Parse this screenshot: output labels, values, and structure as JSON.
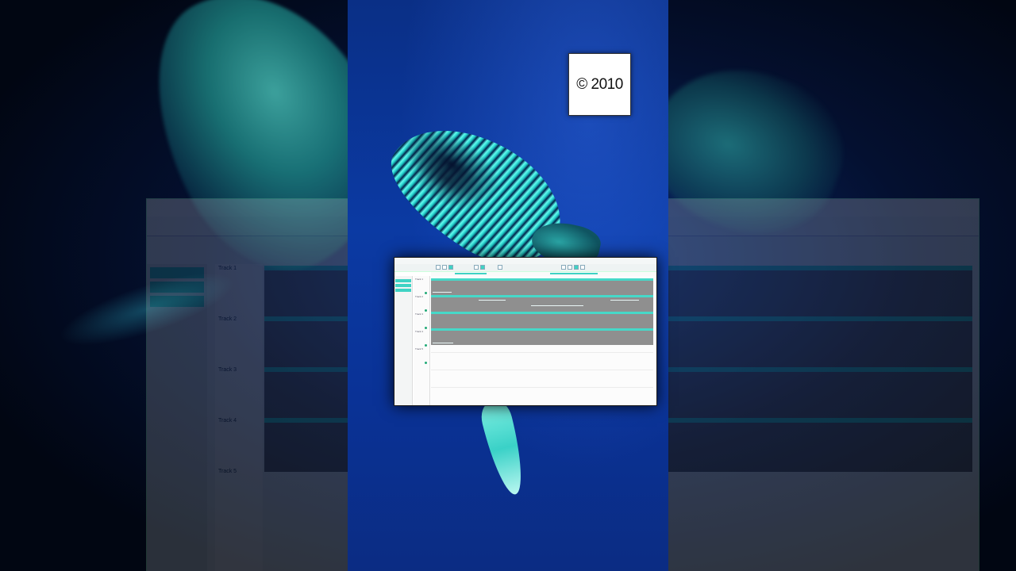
{
  "overlay": {
    "copyright": "© 2010"
  },
  "daw": {
    "tracks": [
      {
        "label": "Track 1"
      },
      {
        "label": "Track 2"
      },
      {
        "label": "Track 3"
      },
      {
        "label": "Track 4"
      },
      {
        "label": "Track 5"
      }
    ],
    "accent_color": "#3fd3c4"
  },
  "scene": {
    "background_color": "#0b3aa3",
    "subject": "humpback-whale"
  }
}
